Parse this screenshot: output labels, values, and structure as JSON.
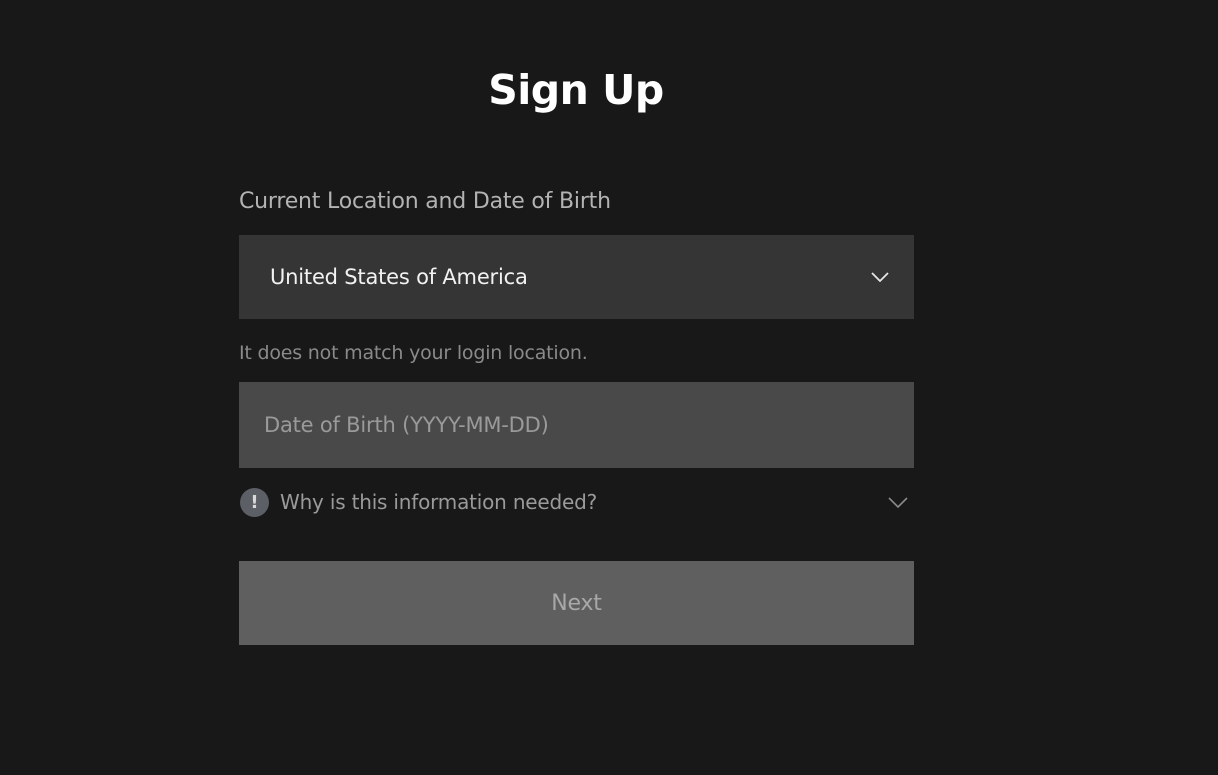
{
  "header": {
    "title": "Sign Up"
  },
  "form": {
    "section_label": "Current Location and Date of Birth",
    "country": {
      "selected": "United States of America",
      "icon": "chevron-down-icon"
    },
    "location_hint": "It does not match your login location.",
    "dob": {
      "value": "",
      "placeholder": "Date of Birth (YYYY-MM-DD)"
    },
    "why_needed": {
      "icon_glyph": "!",
      "label": "Why is this information needed?",
      "icon": "chevron-down-icon"
    },
    "next_label": "Next"
  },
  "colors": {
    "background": "#181818",
    "select_bg": "#353535",
    "input_bg": "#494949",
    "button_bg": "#5f5f5f"
  }
}
